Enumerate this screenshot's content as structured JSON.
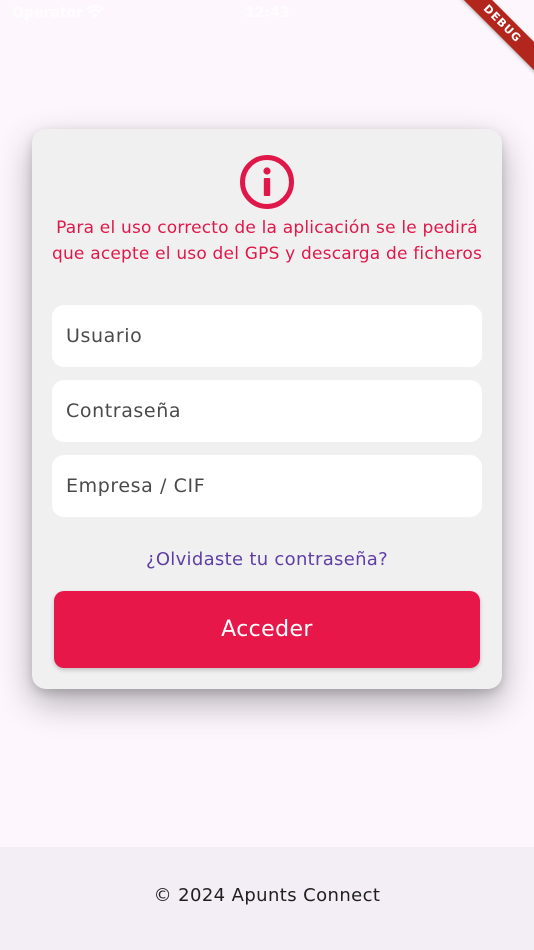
{
  "status_bar": {
    "carrier": "Operator",
    "time": "12:43"
  },
  "debug_banner": "DEBUG",
  "login_card": {
    "info_icon": "info-circle-icon",
    "notice": "Para el uso correcto de la aplicación se le pedirá que acepte el uso del GPS y descarga de ficheros",
    "username_placeholder": "Usuario",
    "password_placeholder": "Contraseña",
    "company_placeholder": "Empresa / CIF",
    "forgot_password": "¿Olvidaste tu contraseña?",
    "submit_label": "Acceder"
  },
  "footer": {
    "text": "© 2024 Apunts Connect"
  },
  "colors": {
    "accent": "#e8174a",
    "link": "#5e3fa3",
    "background": "#fdf7fd",
    "card": "#f1f0f1"
  }
}
